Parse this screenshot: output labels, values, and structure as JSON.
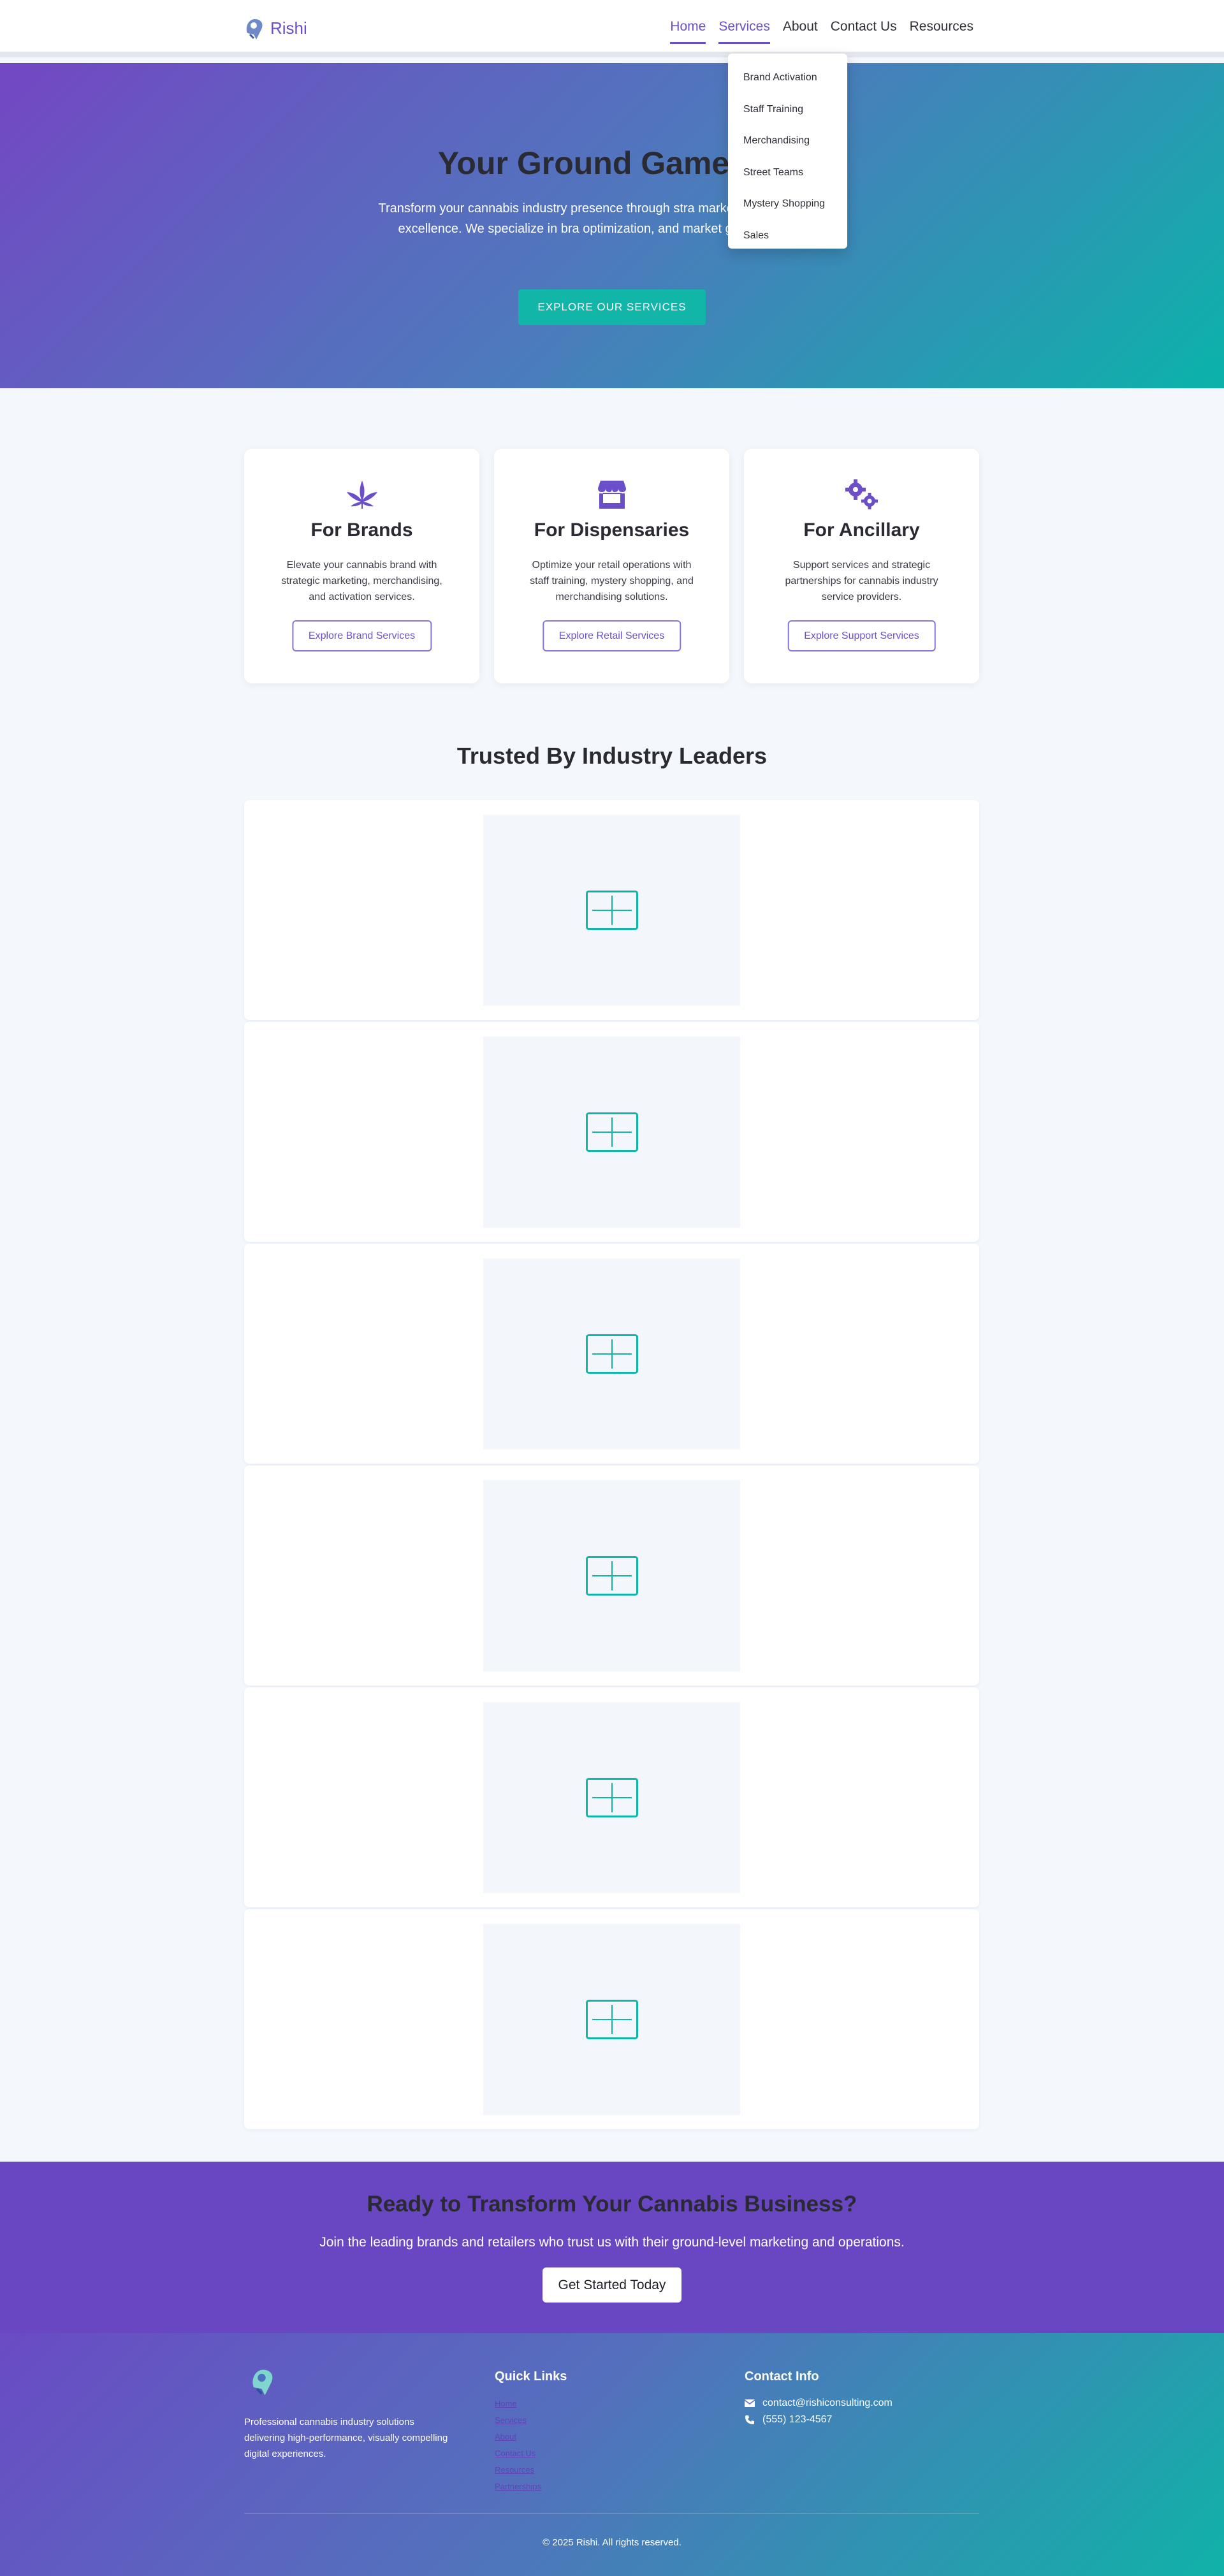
{
  "header": {
    "logo_text": "Rishi",
    "nav": [
      "Home",
      "Services",
      "About",
      "Contact Us",
      "Resources"
    ],
    "services_dropdown": [
      "Brand Activation",
      "Staff Training",
      "Merchandising",
      "Street Teams",
      "Mystery Shopping",
      "Sales"
    ]
  },
  "hero": {
    "title": "Your Ground Game Ele",
    "subtitle": "Transform your cannabis industry presence through stra marketing and operational excellence. We specialize in bra optimization, and market growth strategies.",
    "button": "EXPLORE OUR SERVICES"
  },
  "cards": [
    {
      "icon": "cannabis-leaf-icon",
      "title": "For Brands",
      "desc": "Elevate your cannabis brand with strategic marketing, merchandising, and activation services.",
      "button": "Explore Brand Services"
    },
    {
      "icon": "storefront-icon",
      "title": "For Dispensaries",
      "desc": "Optimize your retail operations with staff training, mystery shopping, and merchandising solutions.",
      "button": "Explore Retail Services"
    },
    {
      "icon": "gears-icon",
      "title": "For Ancillary",
      "desc": "Support services and strategic partnerships for cannabis industry service providers.",
      "button": "Explore Support Services"
    }
  ],
  "trusted": {
    "title": "Trusted By Industry Leaders",
    "logo_count": 6
  },
  "cta": {
    "title": "Ready to Transform Your Cannabis Business?",
    "subtitle": "Join the leading brands and retailers who trust us with their ground-level marketing and operations.",
    "button": "Get Started Today"
  },
  "footer": {
    "description": "Professional cannabis industry solutions delivering high-performance, visually compelling digital experiences.",
    "quick_links_title": "Quick Links",
    "quick_links": [
      "Home",
      "Services",
      "About",
      "Contact Us",
      "Resources",
      "Partnerships"
    ],
    "contact_title": "Contact Info",
    "email": "contact@rishiconsulting.com",
    "phone": "(555) 123-4567",
    "copyright": "© 2025 Rishi. All rights reserved."
  },
  "colors": {
    "brand_purple": "#6a4fc9",
    "teal": "#12b6a8"
  }
}
